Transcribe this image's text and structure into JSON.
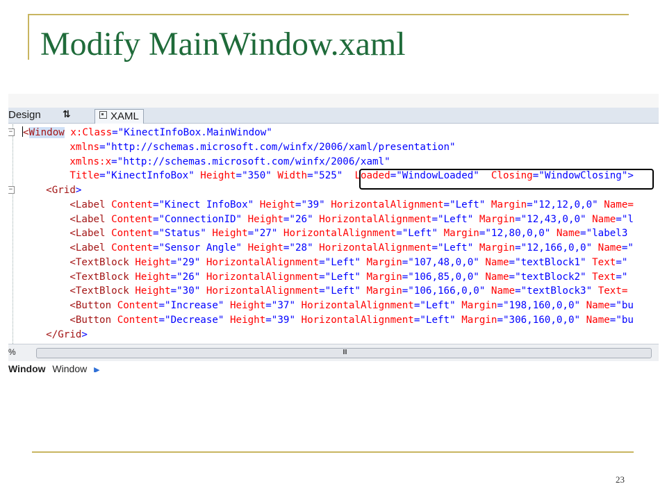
{
  "slide": {
    "title": "Modify MainWindow.xaml",
    "page_number": "23",
    "accent_color": "#c8b560",
    "title_color": "#1f6b3a"
  },
  "editor": {
    "tabs": {
      "design": "Design",
      "swap": "⇅",
      "xaml": "XAML"
    },
    "code_lines": [
      [
        [
          "t",
          "<"
        ],
        [
          "t",
          "Window"
        ],
        [
          "x",
          " "
        ],
        [
          "a",
          "x:Class"
        ],
        [
          "p",
          "=\""
        ],
        [
          "v",
          "KinectInfoBox.MainWindow"
        ],
        [
          "p",
          "\""
        ]
      ],
      [
        [
          "x",
          "        "
        ],
        [
          "a",
          "xmlns"
        ],
        [
          "p",
          "=\""
        ],
        [
          "v",
          "http://schemas.microsoft.com/winfx/2006/xaml/presentation"
        ],
        [
          "p",
          "\""
        ]
      ],
      [
        [
          "x",
          "        "
        ],
        [
          "a",
          "xmlns:x"
        ],
        [
          "p",
          "=\""
        ],
        [
          "v",
          "http://schemas.microsoft.com/winfx/2006/xaml"
        ],
        [
          "p",
          "\""
        ]
      ],
      [
        [
          "x",
          "        "
        ],
        [
          "a",
          "Title"
        ],
        [
          "p",
          "=\""
        ],
        [
          "v",
          "KinectInfoBox"
        ],
        [
          "p",
          "\""
        ],
        [
          "x",
          " "
        ],
        [
          "a",
          "Height"
        ],
        [
          "p",
          "=\""
        ],
        [
          "v",
          "350"
        ],
        [
          "p",
          "\""
        ],
        [
          "x",
          " "
        ],
        [
          "a",
          "Width"
        ],
        [
          "p",
          "=\""
        ],
        [
          "v",
          "525"
        ],
        [
          "p",
          "\""
        ],
        [
          "x",
          "  "
        ],
        [
          "a",
          "Loaded"
        ],
        [
          "p",
          "=\""
        ],
        [
          "v",
          "WindowLoaded"
        ],
        [
          "p",
          "\""
        ],
        [
          "x",
          "  "
        ],
        [
          "a",
          "Closing"
        ],
        [
          "p",
          "=\""
        ],
        [
          "v",
          "WindowClosing"
        ],
        [
          "p",
          "\">"
        ]
      ],
      [
        [
          "x",
          "    "
        ],
        [
          "t",
          "<Grid"
        ],
        [
          "p",
          ">"
        ]
      ],
      [
        [
          "x",
          "        "
        ],
        [
          "t",
          "<Label"
        ],
        [
          "x",
          " "
        ],
        [
          "a",
          "Content"
        ],
        [
          "p",
          "=\""
        ],
        [
          "v",
          "Kinect InfoBox"
        ],
        [
          "p",
          "\""
        ],
        [
          "x",
          " "
        ],
        [
          "a",
          "Height"
        ],
        [
          "p",
          "=\""
        ],
        [
          "v",
          "39"
        ],
        [
          "p",
          "\""
        ],
        [
          "x",
          " "
        ],
        [
          "a",
          "HorizontalAlignment"
        ],
        [
          "p",
          "=\""
        ],
        [
          "v",
          "Left"
        ],
        [
          "p",
          "\""
        ],
        [
          "x",
          " "
        ],
        [
          "a",
          "Margin"
        ],
        [
          "p",
          "=\""
        ],
        [
          "v",
          "12,12,0,0"
        ],
        [
          "p",
          "\""
        ],
        [
          "x",
          " "
        ],
        [
          "a",
          "Name="
        ]
      ],
      [
        [
          "x",
          "        "
        ],
        [
          "t",
          "<Label"
        ],
        [
          "x",
          " "
        ],
        [
          "a",
          "Content"
        ],
        [
          "p",
          "=\""
        ],
        [
          "v",
          "ConnectionID"
        ],
        [
          "p",
          "\""
        ],
        [
          "x",
          " "
        ],
        [
          "a",
          "Height"
        ],
        [
          "p",
          "=\""
        ],
        [
          "v",
          "26"
        ],
        [
          "p",
          "\""
        ],
        [
          "x",
          " "
        ],
        [
          "a",
          "HorizontalAlignment"
        ],
        [
          "p",
          "=\""
        ],
        [
          "v",
          "Left"
        ],
        [
          "p",
          "\""
        ],
        [
          "x",
          " "
        ],
        [
          "a",
          "Margin"
        ],
        [
          "p",
          "=\""
        ],
        [
          "v",
          "12,43,0,0"
        ],
        [
          "p",
          "\""
        ],
        [
          "x",
          " "
        ],
        [
          "a",
          "Name"
        ],
        [
          "p",
          "=\""
        ],
        [
          "v",
          "l"
        ]
      ],
      [
        [
          "x",
          "        "
        ],
        [
          "t",
          "<Label"
        ],
        [
          "x",
          " "
        ],
        [
          "a",
          "Content"
        ],
        [
          "p",
          "=\""
        ],
        [
          "v",
          "Status"
        ],
        [
          "p",
          "\""
        ],
        [
          "x",
          " "
        ],
        [
          "a",
          "Height"
        ],
        [
          "p",
          "=\""
        ],
        [
          "v",
          "27"
        ],
        [
          "p",
          "\""
        ],
        [
          "x",
          " "
        ],
        [
          "a",
          "HorizontalAlignment"
        ],
        [
          "p",
          "=\""
        ],
        [
          "v",
          "Left"
        ],
        [
          "p",
          "\""
        ],
        [
          "x",
          " "
        ],
        [
          "a",
          "Margin"
        ],
        [
          "p",
          "=\""
        ],
        [
          "v",
          "12,80,0,0"
        ],
        [
          "p",
          "\""
        ],
        [
          "x",
          " "
        ],
        [
          "a",
          "Name"
        ],
        [
          "p",
          "=\""
        ],
        [
          "v",
          "label3"
        ]
      ],
      [
        [
          "x",
          "        "
        ],
        [
          "t",
          "<Label"
        ],
        [
          "x",
          " "
        ],
        [
          "a",
          "Content"
        ],
        [
          "p",
          "=\""
        ],
        [
          "v",
          "Sensor Angle"
        ],
        [
          "p",
          "\""
        ],
        [
          "x",
          " "
        ],
        [
          "a",
          "Height"
        ],
        [
          "p",
          "=\""
        ],
        [
          "v",
          "28"
        ],
        [
          "p",
          "\""
        ],
        [
          "x",
          " "
        ],
        [
          "a",
          "HorizontalAlignment"
        ],
        [
          "p",
          "=\""
        ],
        [
          "v",
          "Left"
        ],
        [
          "p",
          "\""
        ],
        [
          "x",
          " "
        ],
        [
          "a",
          "Margin"
        ],
        [
          "p",
          "=\""
        ],
        [
          "v",
          "12,166,0,0"
        ],
        [
          "p",
          "\""
        ],
        [
          "x",
          " "
        ],
        [
          "a",
          "Name"
        ],
        [
          "p",
          "=\""
        ]
      ],
      [
        [
          "x",
          "        "
        ],
        [
          "t",
          "<TextBlock"
        ],
        [
          "x",
          " "
        ],
        [
          "a",
          "Height"
        ],
        [
          "p",
          "=\""
        ],
        [
          "v",
          "29"
        ],
        [
          "p",
          "\""
        ],
        [
          "x",
          " "
        ],
        [
          "a",
          "HorizontalAlignment"
        ],
        [
          "p",
          "=\""
        ],
        [
          "v",
          "Left"
        ],
        [
          "p",
          "\""
        ],
        [
          "x",
          " "
        ],
        [
          "a",
          "Margin"
        ],
        [
          "p",
          "=\""
        ],
        [
          "v",
          "107,48,0,0"
        ],
        [
          "p",
          "\""
        ],
        [
          "x",
          " "
        ],
        [
          "a",
          "Name"
        ],
        [
          "p",
          "=\""
        ],
        [
          "v",
          "textBlock1"
        ],
        [
          "p",
          "\""
        ],
        [
          "x",
          " "
        ],
        [
          "a",
          "Text"
        ],
        [
          "p",
          "=\""
        ]
      ],
      [
        [
          "x",
          "        "
        ],
        [
          "t",
          "<TextBlock"
        ],
        [
          "x",
          " "
        ],
        [
          "a",
          "Height"
        ],
        [
          "p",
          "=\""
        ],
        [
          "v",
          "26"
        ],
        [
          "p",
          "\""
        ],
        [
          "x",
          " "
        ],
        [
          "a",
          "HorizontalAlignment"
        ],
        [
          "p",
          "=\""
        ],
        [
          "v",
          "Left"
        ],
        [
          "p",
          "\""
        ],
        [
          "x",
          " "
        ],
        [
          "a",
          "Margin"
        ],
        [
          "p",
          "=\""
        ],
        [
          "v",
          "106,85,0,0"
        ],
        [
          "p",
          "\""
        ],
        [
          "x",
          " "
        ],
        [
          "a",
          "Name"
        ],
        [
          "p",
          "=\""
        ],
        [
          "v",
          "textBlock2"
        ],
        [
          "p",
          "\""
        ],
        [
          "x",
          " "
        ],
        [
          "a",
          "Text"
        ],
        [
          "p",
          "=\""
        ]
      ],
      [
        [
          "x",
          "        "
        ],
        [
          "t",
          "<TextBlock"
        ],
        [
          "x",
          " "
        ],
        [
          "a",
          "Height"
        ],
        [
          "p",
          "=\""
        ],
        [
          "v",
          "30"
        ],
        [
          "p",
          "\""
        ],
        [
          "x",
          " "
        ],
        [
          "a",
          "HorizontalAlignment"
        ],
        [
          "p",
          "=\""
        ],
        [
          "v",
          "Left"
        ],
        [
          "p",
          "\""
        ],
        [
          "x",
          " "
        ],
        [
          "a",
          "Margin"
        ],
        [
          "p",
          "=\""
        ],
        [
          "v",
          "106,166,0,0"
        ],
        [
          "p",
          "\""
        ],
        [
          "x",
          " "
        ],
        [
          "a",
          "Name"
        ],
        [
          "p",
          "=\""
        ],
        [
          "v",
          "textBlock3"
        ],
        [
          "p",
          "\""
        ],
        [
          "x",
          " "
        ],
        [
          "a",
          "Text="
        ]
      ],
      [
        [
          "x",
          "        "
        ],
        [
          "t",
          "<Button"
        ],
        [
          "x",
          " "
        ],
        [
          "a",
          "Content"
        ],
        [
          "p",
          "=\""
        ],
        [
          "v",
          "Increase"
        ],
        [
          "p",
          "\""
        ],
        [
          "x",
          " "
        ],
        [
          "a",
          "Height"
        ],
        [
          "p",
          "=\""
        ],
        [
          "v",
          "37"
        ],
        [
          "p",
          "\""
        ],
        [
          "x",
          " "
        ],
        [
          "a",
          "HorizontalAlignment"
        ],
        [
          "p",
          "=\""
        ],
        [
          "v",
          "Left"
        ],
        [
          "p",
          "\""
        ],
        [
          "x",
          " "
        ],
        [
          "a",
          "Margin"
        ],
        [
          "p",
          "=\""
        ],
        [
          "v",
          "198,160,0,0"
        ],
        [
          "p",
          "\""
        ],
        [
          "x",
          " "
        ],
        [
          "a",
          "Name"
        ],
        [
          "p",
          "=\""
        ],
        [
          "v",
          "bu"
        ]
      ],
      [
        [
          "x",
          "        "
        ],
        [
          "t",
          "<Button"
        ],
        [
          "x",
          " "
        ],
        [
          "a",
          "Content"
        ],
        [
          "p",
          "=\""
        ],
        [
          "v",
          "Decrease"
        ],
        [
          "p",
          "\""
        ],
        [
          "x",
          " "
        ],
        [
          "a",
          "Height"
        ],
        [
          "p",
          "=\""
        ],
        [
          "v",
          "39"
        ],
        [
          "p",
          "\""
        ],
        [
          "x",
          " "
        ],
        [
          "a",
          "HorizontalAlignment"
        ],
        [
          "p",
          "=\""
        ],
        [
          "v",
          "Left"
        ],
        [
          "p",
          "\""
        ],
        [
          "x",
          " "
        ],
        [
          "a",
          "Margin"
        ],
        [
          "p",
          "=\""
        ],
        [
          "v",
          "306,160,0,0"
        ],
        [
          "p",
          "\""
        ],
        [
          "x",
          " "
        ],
        [
          "a",
          "Name"
        ],
        [
          "p",
          "=\""
        ],
        [
          "v",
          "bu"
        ]
      ],
      [
        [
          "x",
          "    "
        ],
        [
          "t",
          "</Grid"
        ],
        [
          "p",
          ">"
        ]
      ]
    ],
    "status": {
      "zoom": "%",
      "scroll_grip": "III",
      "crumb_1": "Window",
      "crumb_2": "Window"
    }
  }
}
